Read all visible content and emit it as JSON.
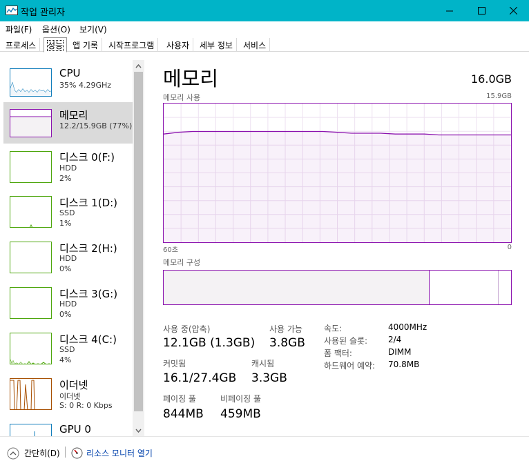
{
  "window": {
    "title": "작업 관리자",
    "icon": "task-manager-icon",
    "accent": "#00b4c8"
  },
  "menu": [
    "파일(F)",
    "옵션(O)",
    "보기(V)"
  ],
  "tabs": [
    "프로세스",
    "성능",
    "앱 기록",
    "시작프로그램",
    "사용자",
    "세부 정보",
    "서비스"
  ],
  "active_tab": "성능",
  "sidebar": {
    "items": [
      {
        "name": "CPU",
        "line1": "35% 4.29GHz",
        "line2": "",
        "color": "#117dbb"
      },
      {
        "name": "메모리",
        "line1": "12.2/15.9GB (77%)",
        "line2": "",
        "color": "#8b12ae"
      },
      {
        "name": "디스크 0(F:)",
        "line1": "HDD",
        "line2": "2%",
        "color": "#4da60c"
      },
      {
        "name": "디스크 1(D:)",
        "line1": "SSD",
        "line2": "1%",
        "color": "#4da60c"
      },
      {
        "name": "디스크 2(H:)",
        "line1": "HDD",
        "line2": "0%",
        "color": "#4da60c"
      },
      {
        "name": "디스크 3(G:)",
        "line1": "HDD",
        "line2": "0%",
        "color": "#4da60c"
      },
      {
        "name": "디스크 4(C:)",
        "line1": "SSD",
        "line2": "4%",
        "color": "#4da60c"
      },
      {
        "name": "이더넷",
        "line1": "이더넷",
        "line2": "S: 0  R: 0 Kbps",
        "color": "#a74f01"
      },
      {
        "name": "GPU 0",
        "line1": "",
        "line2": "",
        "color": "#117dbb"
      }
    ]
  },
  "main": {
    "title": "메모리",
    "total": "16.0GB",
    "usage_label": "메모리 사용",
    "usage_max": "15.9GB",
    "time_left": "60초",
    "time_right": "0",
    "composition_label": "메모리 구성",
    "accent": "#8b12ae",
    "chart_data": {
      "type": "area",
      "x_range": [
        60,
        0
      ],
      "ylim": [
        0,
        15.9
      ],
      "values": [
        12.4,
        12.6,
        12.7,
        12.7,
        12.7,
        12.7,
        12.7,
        12.7,
        12.7,
        12.7,
        12.7,
        12.7,
        12.6,
        12.5,
        12.5,
        12.5,
        12.4,
        12.4,
        12.4,
        12.3,
        12.3,
        12.3,
        12.3,
        12.3,
        12.3
      ]
    },
    "composition": {
      "in_use_fraction": 0.765,
      "standby_fraction": 0.965
    },
    "stats": {
      "in_use_label": "사용 중(압축)",
      "in_use_value": "12.1GB (1.3GB)",
      "available_label": "사용 가능",
      "available_value": "3.8GB",
      "committed_label": "커밋됨",
      "committed_value": "16.1/27.4GB",
      "cached_label": "캐시됨",
      "cached_value": "3.3GB",
      "paged_label": "페이징 풀",
      "paged_value": "844MB",
      "nonpaged_label": "비페이징 풀",
      "nonpaged_value": "459MB"
    },
    "details": [
      {
        "key": "속도:",
        "value": "4000MHz"
      },
      {
        "key": "사용된 슬롯:",
        "value": "2/4"
      },
      {
        "key": "폼 팩터:",
        "value": "DIMM"
      },
      {
        "key": "하드웨어 예약:",
        "value": "70.8MB"
      }
    ]
  },
  "footer": {
    "fewer_details": "간단히(D)",
    "open_resmon": "리소스 모니터 열기"
  }
}
